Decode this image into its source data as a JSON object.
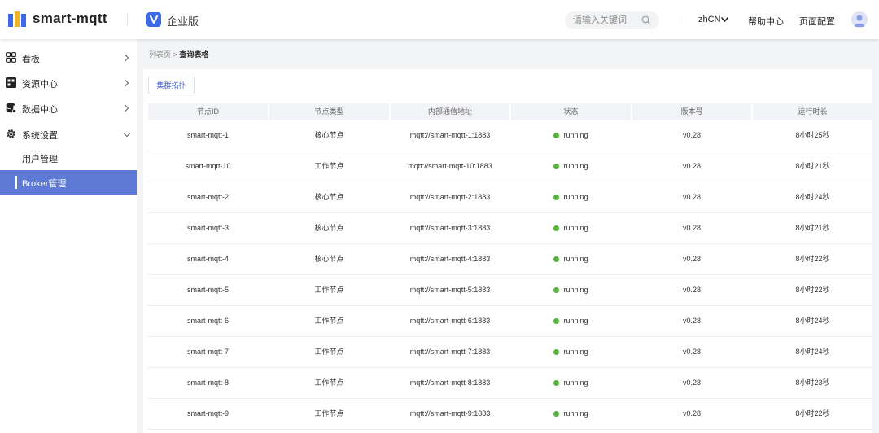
{
  "header": {
    "app_title": "smart-mqtt",
    "edition": "企业版",
    "search_placeholder": "请输入关键词",
    "lang": "zhCN",
    "help": "帮助中心",
    "page_config": "页面配置",
    "brand_color": "#3d6be8"
  },
  "sidebar": {
    "items": [
      {
        "label": "看板",
        "icon": "dashboard-icon"
      },
      {
        "label": "资源中心",
        "icon": "resource-icon"
      },
      {
        "label": "数据中心",
        "icon": "database-icon"
      },
      {
        "label": "系统设置",
        "icon": "gear-icon"
      }
    ],
    "sub_items": [
      {
        "label": "用户管理"
      },
      {
        "label": "Broker管理",
        "active": true
      }
    ],
    "active_color": "#5e7ad6"
  },
  "breadcrumb": {
    "parent": "列表页",
    "separator": ">",
    "current": "查询表格"
  },
  "toolbar": {
    "topology_button": "集群拓扑"
  },
  "table": {
    "columns": [
      "节点ID",
      "节点类型",
      "内部通信地址",
      "状态",
      "版本号",
      "运行时长"
    ],
    "rows": [
      {
        "id": "smart-mqtt-1",
        "type": "核心节点",
        "address": "mqtt://smart-mqtt-1:1883",
        "status": "running",
        "version": "v0.28",
        "uptime": "8小时25秒"
      },
      {
        "id": "smart-mqtt-10",
        "type": "工作节点",
        "address": "mqtt://smart-mqtt-10:1883",
        "status": "running",
        "version": "v0.28",
        "uptime": "8小时21秒"
      },
      {
        "id": "smart-mqtt-2",
        "type": "核心节点",
        "address": "mqtt://smart-mqtt-2:1883",
        "status": "running",
        "version": "v0.28",
        "uptime": "8小时24秒"
      },
      {
        "id": "smart-mqtt-3",
        "type": "核心节点",
        "address": "mqtt://smart-mqtt-3:1883",
        "status": "running",
        "version": "v0.28",
        "uptime": "8小时21秒"
      },
      {
        "id": "smart-mqtt-4",
        "type": "核心节点",
        "address": "mqtt://smart-mqtt-4:1883",
        "status": "running",
        "version": "v0.28",
        "uptime": "8小时22秒"
      },
      {
        "id": "smart-mqtt-5",
        "type": "工作节点",
        "address": "mqtt://smart-mqtt-5:1883",
        "status": "running",
        "version": "v0.28",
        "uptime": "8小时22秒"
      },
      {
        "id": "smart-mqtt-6",
        "type": "工作节点",
        "address": "mqtt://smart-mqtt-6:1883",
        "status": "running",
        "version": "v0.28",
        "uptime": "8小时24秒"
      },
      {
        "id": "smart-mqtt-7",
        "type": "工作节点",
        "address": "mqtt://smart-mqtt-7:1883",
        "status": "running",
        "version": "v0.28",
        "uptime": "8小时24秒"
      },
      {
        "id": "smart-mqtt-8",
        "type": "工作节点",
        "address": "mqtt://smart-mqtt-8:1883",
        "status": "running",
        "version": "v0.28",
        "uptime": "8小时23秒"
      },
      {
        "id": "smart-mqtt-9",
        "type": "工作节点",
        "address": "mqtt://smart-mqtt-9:1883",
        "status": "running",
        "version": "v0.28",
        "uptime": "8小时22秒"
      }
    ],
    "status_color": "#52b43a"
  }
}
